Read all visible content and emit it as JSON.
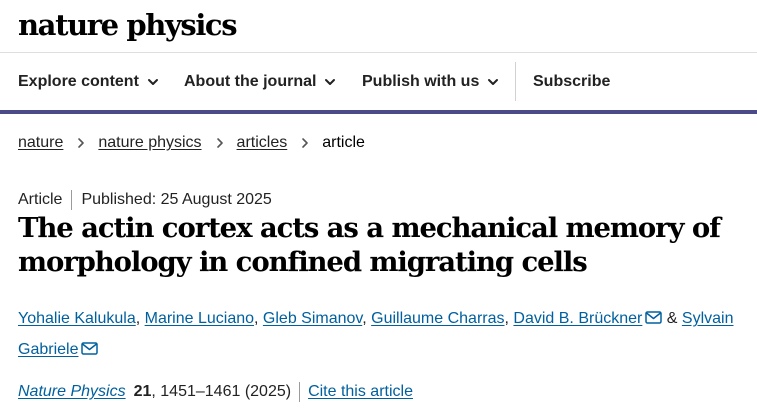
{
  "header": {
    "logo_text": "nature physics"
  },
  "nav": {
    "items": [
      {
        "label": "Explore content",
        "icon": "chevron-down-icon"
      },
      {
        "label": "About the journal",
        "icon": "chevron-down-icon"
      },
      {
        "label": "Publish with us",
        "icon": "chevron-down-icon"
      }
    ],
    "subscribe": "Subscribe",
    "accent_color": "#4c4a89"
  },
  "breadcrumb": {
    "items": [
      "nature",
      "nature physics",
      "articles"
    ],
    "current": "article",
    "separator_icon": "chevron-right-icon"
  },
  "article": {
    "type": "Article",
    "published": "Published: 25 August 2025",
    "title": "The actin cortex acts as a mechanical memory of morphology in confined migrating cells",
    "authors": [
      {
        "name": "Yohalie Kalukula",
        "sep": ", "
      },
      {
        "name": "Marine Luciano",
        "sep": ", "
      },
      {
        "name": "Gleb Simanov",
        "sep": ", "
      },
      {
        "name": "Guillaume Charras",
        "sep": ", "
      },
      {
        "name": "David B. Brückner",
        "sep": " & ",
        "icon": "mail-icon"
      },
      {
        "name": "Sylvain Gabriele",
        "icon": "mail-icon"
      }
    ],
    "link_color": "#00609f"
  },
  "citation": {
    "journal": "Nature Physics",
    "volume": "21",
    "pages": ", 1451–1461 (2025)",
    "cite_label": "Cite this article"
  }
}
